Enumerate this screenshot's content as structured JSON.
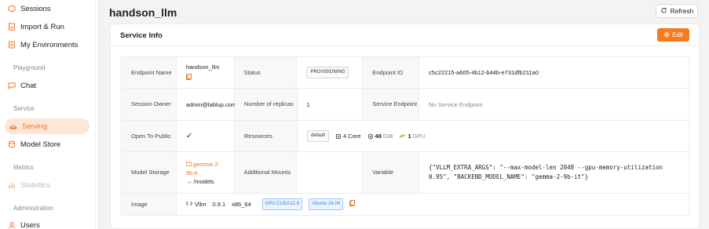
{
  "sidebar": {
    "items": [
      {
        "label": "Sessions"
      },
      {
        "label": "Import & Run"
      },
      {
        "label": "My Environments"
      },
      {
        "label": "Chat"
      },
      {
        "label": "Serving"
      },
      {
        "label": "Model Store"
      },
      {
        "label": "Statistics"
      },
      {
        "label": "Users"
      }
    ],
    "sections": {
      "playground": "Playground",
      "service": "Service",
      "metrics": "Metrics",
      "administration": "Administration"
    }
  },
  "header": {
    "title": "handson_llm",
    "refresh_label": "Refresh"
  },
  "card": {
    "title": "Service Info",
    "edit_label": "Edit"
  },
  "info": {
    "endpoint_name_label": "Endpoint Name",
    "endpoint_name": "handson_llm",
    "status_label": "Status",
    "status": "PROVISIONING",
    "endpoint_id_label": "Endpoint ID",
    "endpoint_id": "c5c22215-a605-4b12-b44b-e731dfb211a0",
    "session_owner_label": "Session Owner",
    "session_owner": "admin@lablup.com",
    "replicas_label": "Number of replicas",
    "replicas": "1",
    "service_endpoint_label": "Service Endpoint",
    "service_endpoint": "No Service Endpoint",
    "open_public_label": "Open To Public",
    "open_public": "✓",
    "resources_label": "Resources",
    "resource_group": "default",
    "cpu": "4 Core",
    "mem_value": "48",
    "mem_unit": "GiB",
    "gpu_value": "1",
    "gpu_unit": "GPU",
    "model_storage_label": "Model Storage",
    "model_folder": "gemma-2-9b-it",
    "model_mount": "→ /models",
    "additional_mounts_label": "Additional Mounts",
    "variable_label": "Variable",
    "variable": "{\"VLLM_EXTRA_ARGS\": \"--max-model-len 2048 --gpu-memory-utilization 0.95\", \"BACKEND_MODEL_NAME\": \"gemma-2-9b-it\"}",
    "image_label": "Image",
    "image_name": "Vllm",
    "image_version": "0.9.1",
    "image_arch": "x86_64",
    "image_tag_cuda": "GPU:CUDA12.8",
    "image_tag_os": "Ubuntu 24.04"
  },
  "colors": {
    "accent": "#f47b20",
    "active_bg": "#fde7d7",
    "chip_blue": "#3a7fdc"
  }
}
